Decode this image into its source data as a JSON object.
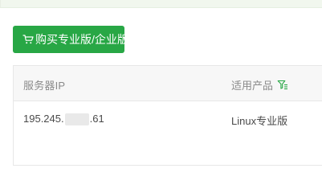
{
  "toolbar": {
    "buy_button_label": "购买专业版/企业版"
  },
  "table": {
    "columns": [
      {
        "label": "服务器IP"
      },
      {
        "label": "适用产品"
      }
    ],
    "rows": [
      {
        "ip_prefix": "195.245.",
        "ip_suffix": ".61",
        "product": "Linux专业版"
      }
    ]
  },
  "colors": {
    "primary_green": "#28a745",
    "header_bg": "#f7f7f7",
    "notice_bg": "#f1f7ee"
  },
  "icons": {
    "cart": "cart-icon",
    "filter": "filter-icon"
  }
}
